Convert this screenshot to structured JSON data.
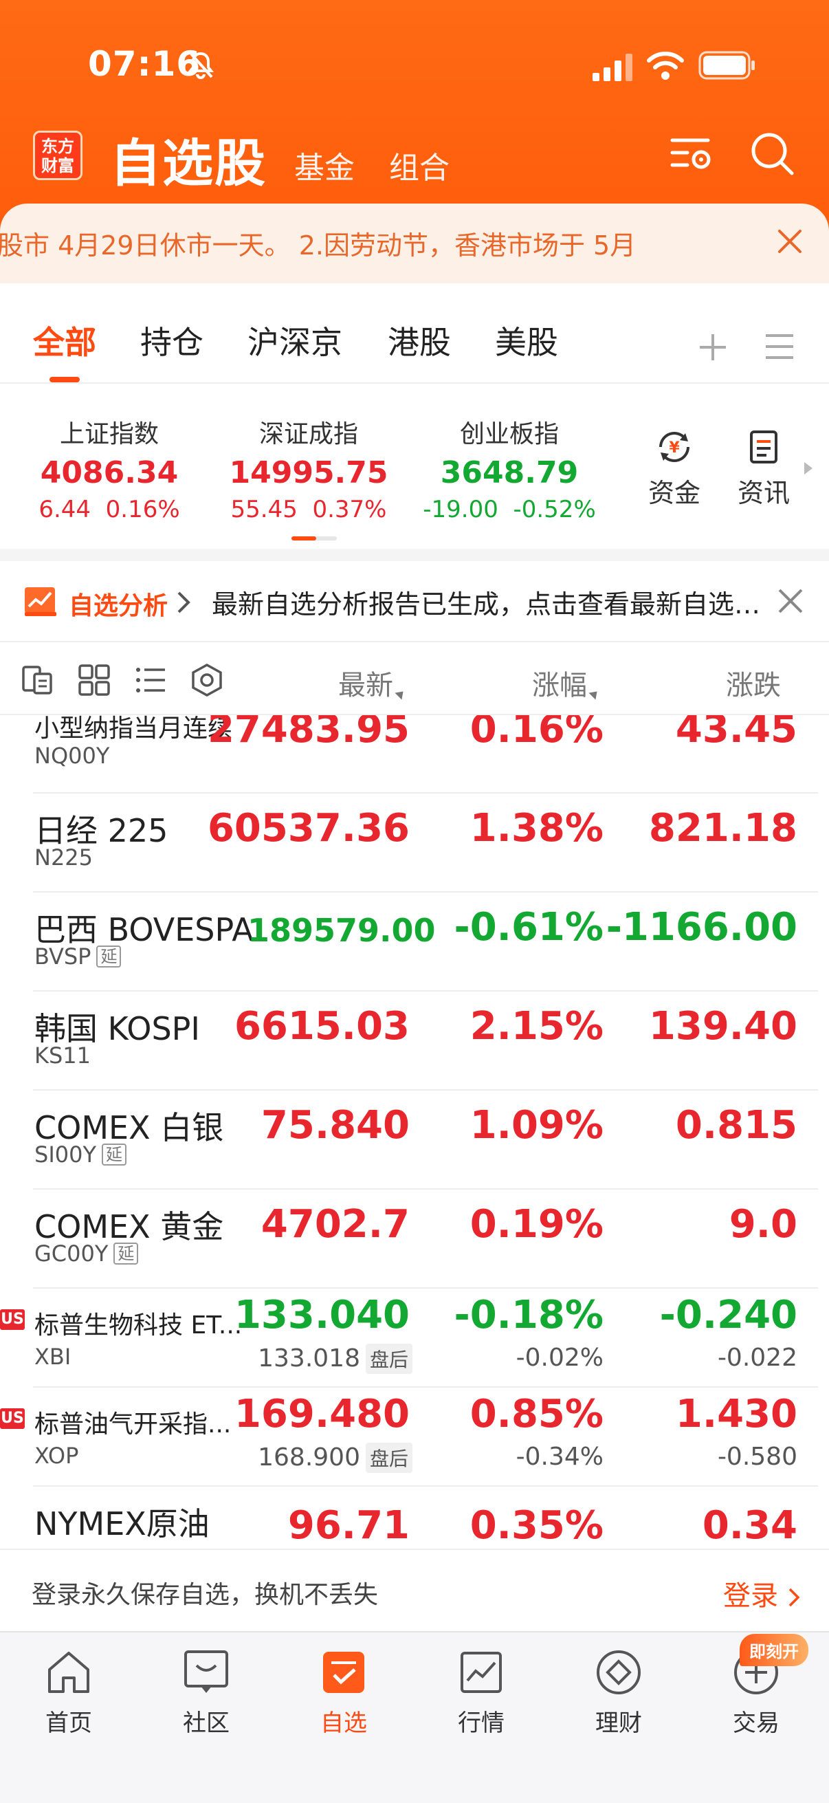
{
  "status": {
    "time": "07:16"
  },
  "header": {
    "logo_line1": "东方",
    "logo_line2": "财富",
    "title": "自选股",
    "tabs": [
      "基金",
      "组合"
    ]
  },
  "notice": {
    "text": "股市 4月29日休市一天。      2.因劳动节，香港市场于 5月"
  },
  "categories": [
    "全部",
    "持仓",
    "沪深京",
    "港股",
    "美股"
  ],
  "indices": [
    {
      "name": "上证指数",
      "value": "4086.34",
      "change": "6.44",
      "pct": "0.16%",
      "trend": "up"
    },
    {
      "name": "深证成指",
      "value": "14995.75",
      "change": "55.45",
      "pct": "0.37%",
      "trend": "up"
    },
    {
      "name": "创业板指",
      "value": "3648.79",
      "change": "-19.00",
      "pct": "-0.52%",
      "trend": "down"
    }
  ],
  "tools": [
    {
      "label": "资金",
      "icon": "fund-flow-icon"
    },
    {
      "label": "资讯",
      "icon": "news-icon"
    }
  ],
  "analysis": {
    "label": "自选分析",
    "text": "最新自选分析报告已生成，点击查看最新自选分析报告"
  },
  "columns": {
    "latest": "最新",
    "pct": "涨幅",
    "change": "涨跌"
  },
  "rows": [
    {
      "name": "小型纳指当月连续",
      "code": "NQ00Y",
      "price": "27483.95",
      "pct": "0.16%",
      "change": "43.45",
      "trend": "up",
      "delay": ""
    },
    {
      "name": "日经 225",
      "code": "N225",
      "price": "60537.36",
      "pct": "1.38%",
      "change": "821.18",
      "trend": "up",
      "delay": ""
    },
    {
      "name": "巴西 BOVESPA",
      "code": "BVSP",
      "price": "189579.00",
      "pct": "-0.61%",
      "change": "-1166.00",
      "trend": "down",
      "delay": "延"
    },
    {
      "name": "韩国 KOSPI",
      "code": "KS11",
      "price": "6615.03",
      "pct": "2.15%",
      "change": "139.40",
      "trend": "up",
      "delay": ""
    },
    {
      "name": "COMEX 白银",
      "code": "SI00Y",
      "price": "75.840",
      "pct": "1.09%",
      "change": "0.815",
      "trend": "up",
      "delay": "延"
    },
    {
      "name": "COMEX 黄金",
      "code": "GC00Y",
      "price": "4702.7",
      "pct": "0.19%",
      "change": "9.0",
      "trend": "up",
      "delay": "延"
    },
    {
      "name": "标普生物科技 ET...",
      "code": "XBI",
      "price": "133.040",
      "pct": "-0.18%",
      "change": "-0.240",
      "trend": "down",
      "market": "US",
      "after_price": "133.018",
      "after_label": "盘后",
      "after_pct": "-0.02%",
      "after_change": "-0.022"
    },
    {
      "name": "标普油气开采指...",
      "code": "XOP",
      "price": "169.480",
      "pct": "0.85%",
      "change": "1.430",
      "trend": "up",
      "market": "US",
      "after_price": "168.900",
      "after_label": "盘后",
      "after_pct": "-0.34%",
      "after_change": "-0.580"
    },
    {
      "name": "NYMEX原油",
      "code": "",
      "price": "96.71",
      "pct": "0.35%",
      "change": "0.34",
      "trend": "up",
      "delay": ""
    }
  ],
  "login": {
    "text": "登录永久保存自选，换机不丢失",
    "link": "登录"
  },
  "nav": [
    {
      "label": "首页",
      "icon": "home-icon"
    },
    {
      "label": "社区",
      "icon": "community-icon"
    },
    {
      "label": "自选",
      "icon": "watchlist-icon",
      "active": true
    },
    {
      "label": "行情",
      "icon": "market-icon"
    },
    {
      "label": "理财",
      "icon": "wealth-icon"
    },
    {
      "label": "交易",
      "icon": "trade-icon"
    }
  ],
  "nav_badge": "即刻开",
  "colors": {
    "brand": "#ff5a0a",
    "up": "#e8262d",
    "down": "#12a832"
  }
}
